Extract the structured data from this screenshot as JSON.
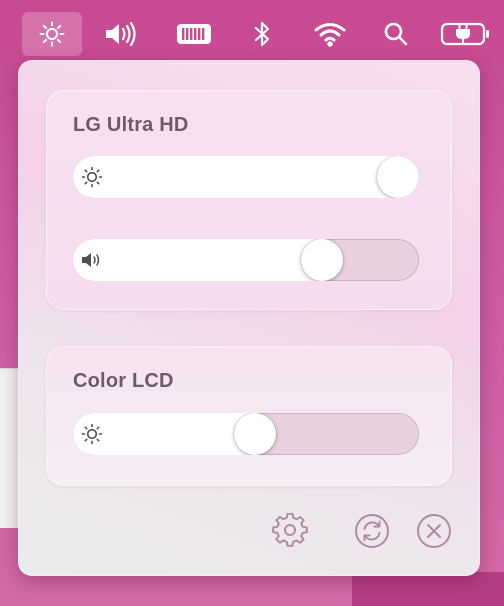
{
  "menubar": {
    "items": [
      {
        "icon": "brightness-icon",
        "active": true
      },
      {
        "icon": "volume-icon"
      },
      {
        "icon": "battery-meter-icon"
      },
      {
        "icon": "bluetooth-icon"
      },
      {
        "icon": "wifi-icon"
      },
      {
        "icon": "search-icon"
      },
      {
        "icon": "power-plug-icon"
      }
    ]
  },
  "displays": [
    {
      "name": "LG Ultra HD",
      "brightness": 1.0,
      "volume": 0.75
    },
    {
      "name": "Color LCD",
      "brightness": 0.53
    }
  ],
  "footer": {
    "icons": [
      "gear-icon",
      "refresh-icon",
      "close-icon"
    ]
  },
  "colors": {
    "desktop": "#c84a92",
    "title_text": "#6e5a6a",
    "footer_icon": "#b08aa4"
  }
}
